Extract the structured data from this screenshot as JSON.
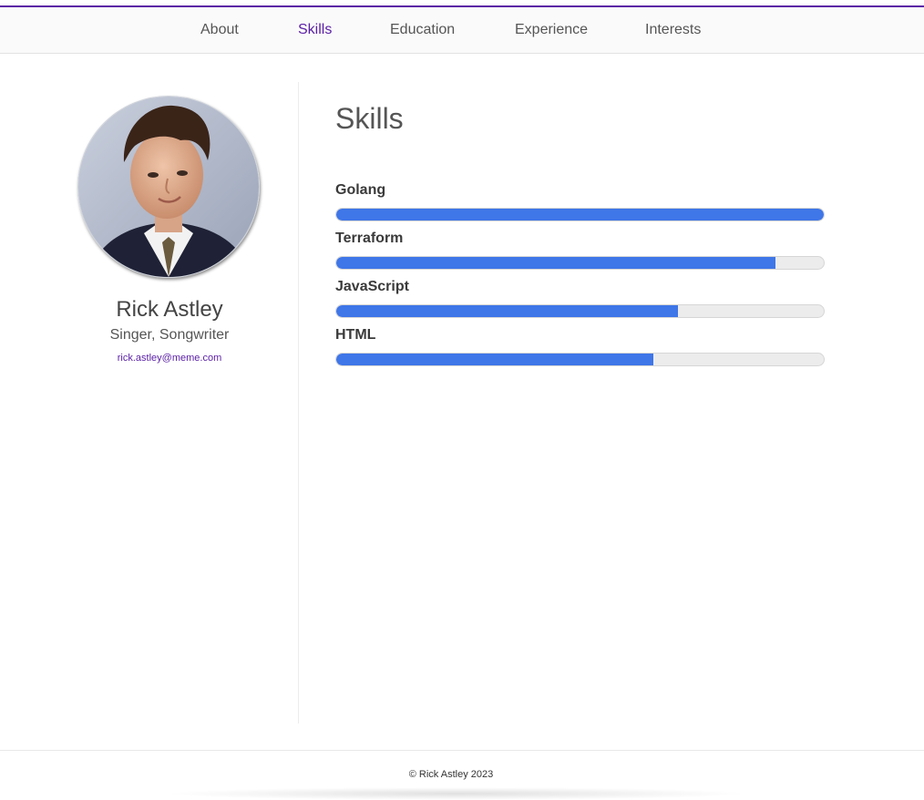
{
  "nav": {
    "items": [
      {
        "label": "About",
        "active": false
      },
      {
        "label": "Skills",
        "active": true
      },
      {
        "label": "Education",
        "active": false
      },
      {
        "label": "Experience",
        "active": false
      },
      {
        "label": "Interests",
        "active": false
      }
    ]
  },
  "profile": {
    "name": "Rick Astley",
    "title": "Singer, Songwriter",
    "email": "rick.astley@meme.com"
  },
  "main": {
    "title": "Skills",
    "skills": [
      {
        "name": "Golang",
        "level": 1.0
      },
      {
        "name": "Terraform",
        "level": 0.9
      },
      {
        "name": "JavaScript",
        "level": 0.7
      },
      {
        "name": "HTML",
        "level": 0.65
      }
    ]
  },
  "footer": {
    "text": "© Rick Astley 2023"
  },
  "colors": {
    "accent": "#5a1ea6",
    "bar_fill": "#3f76e8",
    "bar_track": "#ececec"
  }
}
